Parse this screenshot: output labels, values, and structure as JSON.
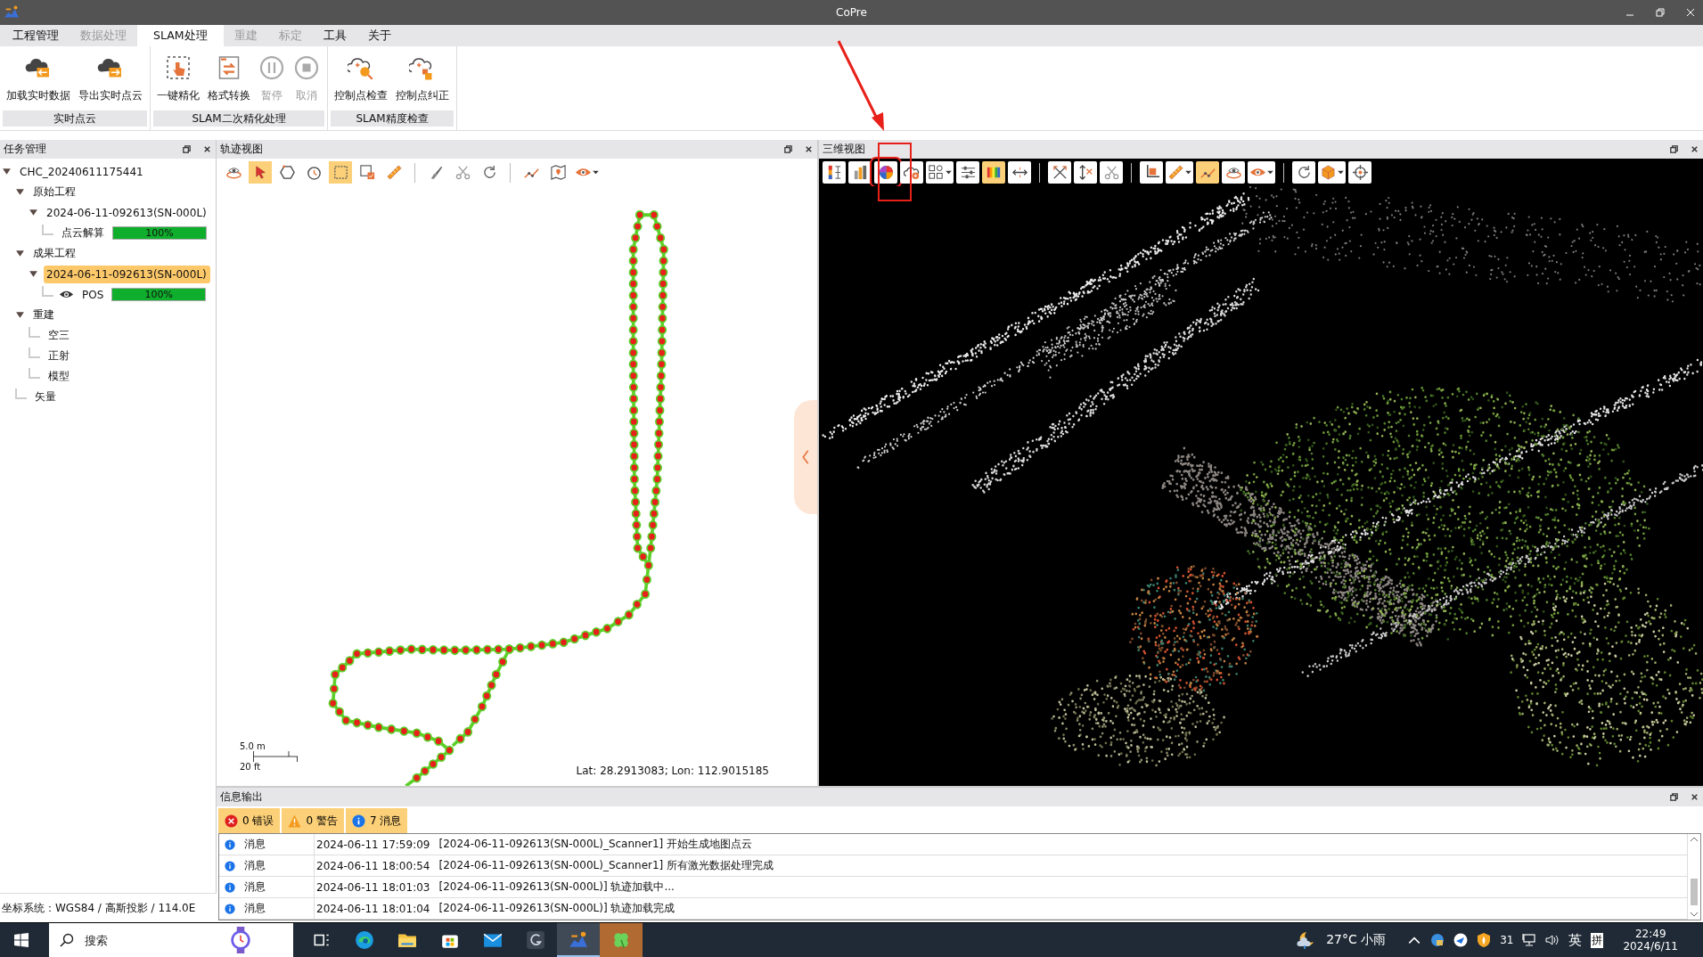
{
  "window": {
    "title": "CoPre"
  },
  "menu_tabs": [
    {
      "label": "工程管理",
      "selected": false,
      "disabled": false
    },
    {
      "label": "数据处理",
      "selected": false,
      "disabled": true
    },
    {
      "label": "SLAM处理",
      "selected": true,
      "disabled": false
    },
    {
      "label": "重建",
      "selected": false,
      "disabled": true
    },
    {
      "label": "标定",
      "selected": false,
      "disabled": true
    },
    {
      "label": "工具",
      "selected": false,
      "disabled": false
    },
    {
      "label": "关于",
      "selected": false,
      "disabled": false
    }
  ],
  "ribbon_groups": [
    {
      "label": "实时点云",
      "buttons": [
        {
          "label": "加载实时数据",
          "kind": "cloud-in",
          "disabled": false
        },
        {
          "label": "导出实时点云",
          "kind": "cloud-out",
          "disabled": false
        }
      ]
    },
    {
      "label": "SLAM二次精化处理",
      "buttons": [
        {
          "label": "一键精化",
          "kind": "refine",
          "disabled": false
        },
        {
          "label": "格式转换",
          "kind": "convert",
          "disabled": false
        },
        {
          "label": "暂停",
          "kind": "pause",
          "disabled": true
        },
        {
          "label": "取消",
          "kind": "stop",
          "disabled": true
        }
      ]
    },
    {
      "label": "SLAM精度检查",
      "buttons": [
        {
          "label": "控制点检查",
          "kind": "cloud-check",
          "disabled": false
        },
        {
          "label": "控制点纠正",
          "kind": "cloud-fix",
          "disabled": false
        }
      ]
    }
  ],
  "task_panel": {
    "title": "任务管理",
    "tree": [
      {
        "label": "CHC_20240611175441",
        "expanded": true,
        "selected": false,
        "children": [
          {
            "label": "原始工程",
            "expanded": true,
            "selected": false,
            "children": [
              {
                "label": "2024-06-11-092613(SN-000L)",
                "expanded": true,
                "selected": false,
                "children": [
                  {
                    "label": "点云解算",
                    "selected": false,
                    "visible": false,
                    "level": 1,
                    "reading": "100%"
                  }
                ]
              }
            ]
          },
          {
            "label": "成果工程",
            "expanded": true,
            "selected": false,
            "children": [
              {
                "label": "2024-06-11-092613(SN-000L)",
                "expanded": true,
                "selected": true,
                "children": [
                  {
                    "label": "POS",
                    "selected": false,
                    "visible": true,
                    "level": 1,
                    "reading": "100%"
                  }
                ]
              }
            ]
          },
          {
            "label": "重建",
            "expanded": true,
            "selected": false,
            "children": [
              {
                "label": "空三",
                "selected": false
              },
              {
                "label": "正射",
                "selected": false
              },
              {
                "label": "模型",
                "selected": false
              }
            ]
          },
          {
            "label": "矢量",
            "selected": false
          }
        ]
      }
    ]
  },
  "trajectory_panel": {
    "title": "轨迹视图",
    "toolbar": [
      [
        {
          "kind": "layer-eye",
          "active": false,
          "dropdown": false
        },
        {
          "kind": "pointer",
          "active": true,
          "dropdown": false
        },
        {
          "kind": "polygon",
          "active": false,
          "dropdown": false
        },
        {
          "kind": "clock",
          "active": false,
          "dropdown": false
        },
        {
          "kind": "select-rect",
          "active": true,
          "dropdown": false
        },
        {
          "kind": "select-check",
          "active": false,
          "dropdown": false
        },
        {
          "kind": "ruler",
          "active": false,
          "dropdown": false
        }
      ],
      [
        {
          "kind": "brush",
          "active": false,
          "dropdown": false
        },
        {
          "kind": "cut",
          "active": false,
          "dropdown": false
        },
        {
          "kind": "rotate",
          "active": false,
          "dropdown": false
        }
      ],
      [
        {
          "kind": "path-edit",
          "active": false,
          "dropdown": false
        },
        {
          "kind": "map",
          "active": false,
          "dropdown": false
        },
        {
          "kind": "eye",
          "active": false,
          "dropdown": true
        }
      ]
    ],
    "scale_bar": {
      "metric": "5.0 m",
      "imperial": "20 ft"
    },
    "coordinates": "Lat: 28.2913083; Lon: 112.9015185"
  },
  "view3d_panel": {
    "title": "三维视图",
    "toolbar": [
      [
        {
          "kind": "color-scale",
          "active": false,
          "dropdown": false,
          "highlighted": false
        },
        {
          "kind": "height-color",
          "active": false,
          "dropdown": false,
          "highlighted": false
        },
        {
          "kind": "rgb",
          "active": false,
          "dropdown": false,
          "highlighted": true
        },
        {
          "kind": "cloud-plus",
          "active": false,
          "dropdown": false,
          "highlighted": false
        },
        {
          "kind": "grid",
          "active": false,
          "dropdown": true,
          "highlighted": false
        },
        {
          "kind": "sliders",
          "active": false,
          "dropdown": false,
          "highlighted": false
        },
        {
          "kind": "rainbow",
          "active": true,
          "dropdown": false,
          "highlighted": false
        },
        {
          "kind": "arrows-h",
          "active": false,
          "dropdown": false,
          "highlighted": false
        }
      ],
      [
        {
          "kind": "axes",
          "active": false,
          "dropdown": false,
          "highlighted": false
        },
        {
          "kind": "arrows-v",
          "active": false,
          "dropdown": false,
          "highlighted": false
        },
        {
          "kind": "cut",
          "active": false,
          "dropdown": false,
          "highlighted": false
        }
      ],
      [
        {
          "kind": "crop",
          "active": false,
          "dropdown": false,
          "highlighted": false
        },
        {
          "kind": "ruler",
          "active": false,
          "dropdown": true,
          "highlighted": false
        },
        {
          "kind": "path-edit",
          "active": true,
          "dropdown": false,
          "highlighted": false
        },
        {
          "kind": "layer-eye",
          "active": false,
          "dropdown": false,
          "highlighted": false
        },
        {
          "kind": "eye",
          "active": false,
          "dropdown": true,
          "highlighted": false
        }
      ],
      [
        {
          "kind": "rotate",
          "active": false,
          "dropdown": false,
          "highlighted": false
        },
        {
          "kind": "cube",
          "active": false,
          "dropdown": true,
          "highlighted": false
        },
        {
          "kind": "target",
          "active": false,
          "dropdown": false,
          "highlighted": false
        }
      ]
    ]
  },
  "info_panel": {
    "title": "信息输出",
    "filters": [
      {
        "kind": "error",
        "label": "0 错误"
      },
      {
        "kind": "warning",
        "label": "0 警告"
      },
      {
        "kind": "info",
        "label": "7 消息"
      }
    ],
    "rows": [
      {
        "type": "消息",
        "time": "2024-06-11 17:59:09",
        "message": "[2024-06-11-092613(SN-000L)_Scanner1] 开始生成地图点云"
      },
      {
        "type": "消息",
        "time": "2024-06-11 18:00:54",
        "message": "[2024-06-11-092613(SN-000L)_Scanner1] 所有激光数据处理完成"
      },
      {
        "type": "消息",
        "time": "2024-06-11 18:01:03",
        "message": "[2024-06-11-092613(SN-000L)] 轨迹加载中..."
      },
      {
        "type": "消息",
        "time": "2024-06-11 18:01:04",
        "message": "[2024-06-11-092613(SN-000L)] 轨迹加载完成"
      }
    ]
  },
  "status_bar": "坐标系统：WGS84 / 高斯投影 / 114.0E",
  "taskbar": {
    "search_placeholder": "搜索",
    "apps": [
      {
        "kind": "task-view",
        "selected": false
      },
      {
        "kind": "browser",
        "selected": false
      },
      {
        "kind": "folder",
        "selected": false
      },
      {
        "kind": "store",
        "selected": false
      },
      {
        "kind": "mail",
        "selected": false
      },
      {
        "kind": "gear-app",
        "selected": false
      },
      {
        "kind": "terrain-app",
        "selected": true
      },
      {
        "kind": "clover",
        "selected": false
      }
    ],
    "weather": "27°C 小雨",
    "tray_badge": "31",
    "ime": "英",
    "ime_mode": "拼",
    "time": "22:49",
    "date": "2024/6/11"
  }
}
